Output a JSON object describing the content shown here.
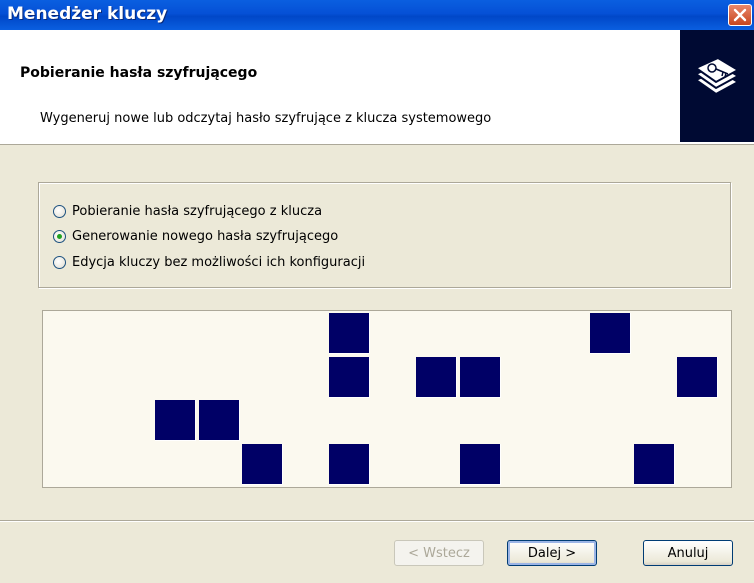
{
  "window": {
    "title": "Menedżer kluczy"
  },
  "header": {
    "title": "Pobieranie hasła szyfrującego",
    "subtitle": "Wygeneruj nowe lub odczytaj hasło szyfrujące z klucza systemowego",
    "icon": "keys-wizard-icon"
  },
  "options": [
    {
      "label": "Pobieranie hasła szyfrującego z klucza",
      "checked": false
    },
    {
      "label": "Generowanie nowego hasła szyfrującego",
      "checked": true
    },
    {
      "label": "Edycja kluczy bez możliwości ich konfiguracji",
      "checked": false
    }
  ],
  "random_grid": {
    "columns": 16,
    "rows": 4,
    "filled_cells": [
      [
        1,
        6
      ],
      [
        1,
        12
      ],
      [
        2,
        6
      ],
      [
        2,
        8
      ],
      [
        2,
        9
      ],
      [
        2,
        14
      ],
      [
        3,
        2
      ],
      [
        3,
        3
      ],
      [
        4,
        4
      ],
      [
        4,
        6
      ],
      [
        4,
        9
      ],
      [
        4,
        13
      ]
    ],
    "cell_color": "#000066"
  },
  "buttons": {
    "back": "< Wstecz",
    "next": "Dalej >",
    "cancel": "Anuluj"
  }
}
